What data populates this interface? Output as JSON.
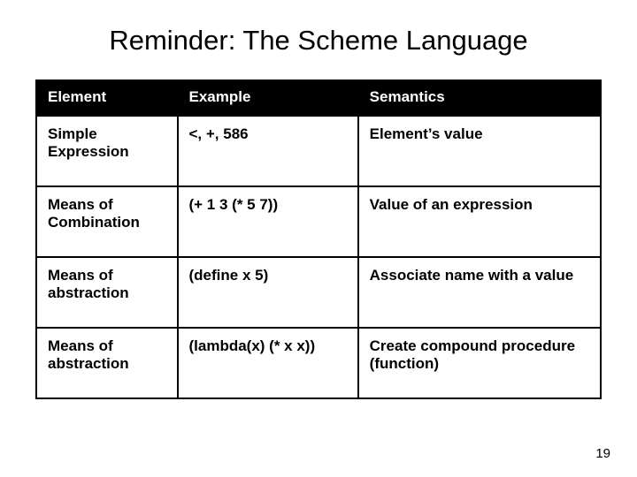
{
  "title": "Reminder: The Scheme Language",
  "headers": {
    "col1": "Element",
    "col2": "Example",
    "col3": "Semantics"
  },
  "rows": [
    {
      "element": "Simple Expression",
      "example": "<, +, 586",
      "semantics": "Element’s value"
    },
    {
      "element": "Means of Combination",
      "example": " (+ 1 3 (* 5 7))",
      "semantics": "Value of an expression"
    },
    {
      "element": "Means of abstraction",
      "example": "(define x 5)",
      "semantics": "Associate name with a value"
    },
    {
      "element": "Means of abstraction",
      "example": "(lambda(x) (* x x))",
      "semantics": "Create compound procedure (function)"
    }
  ],
  "page_number": "19"
}
